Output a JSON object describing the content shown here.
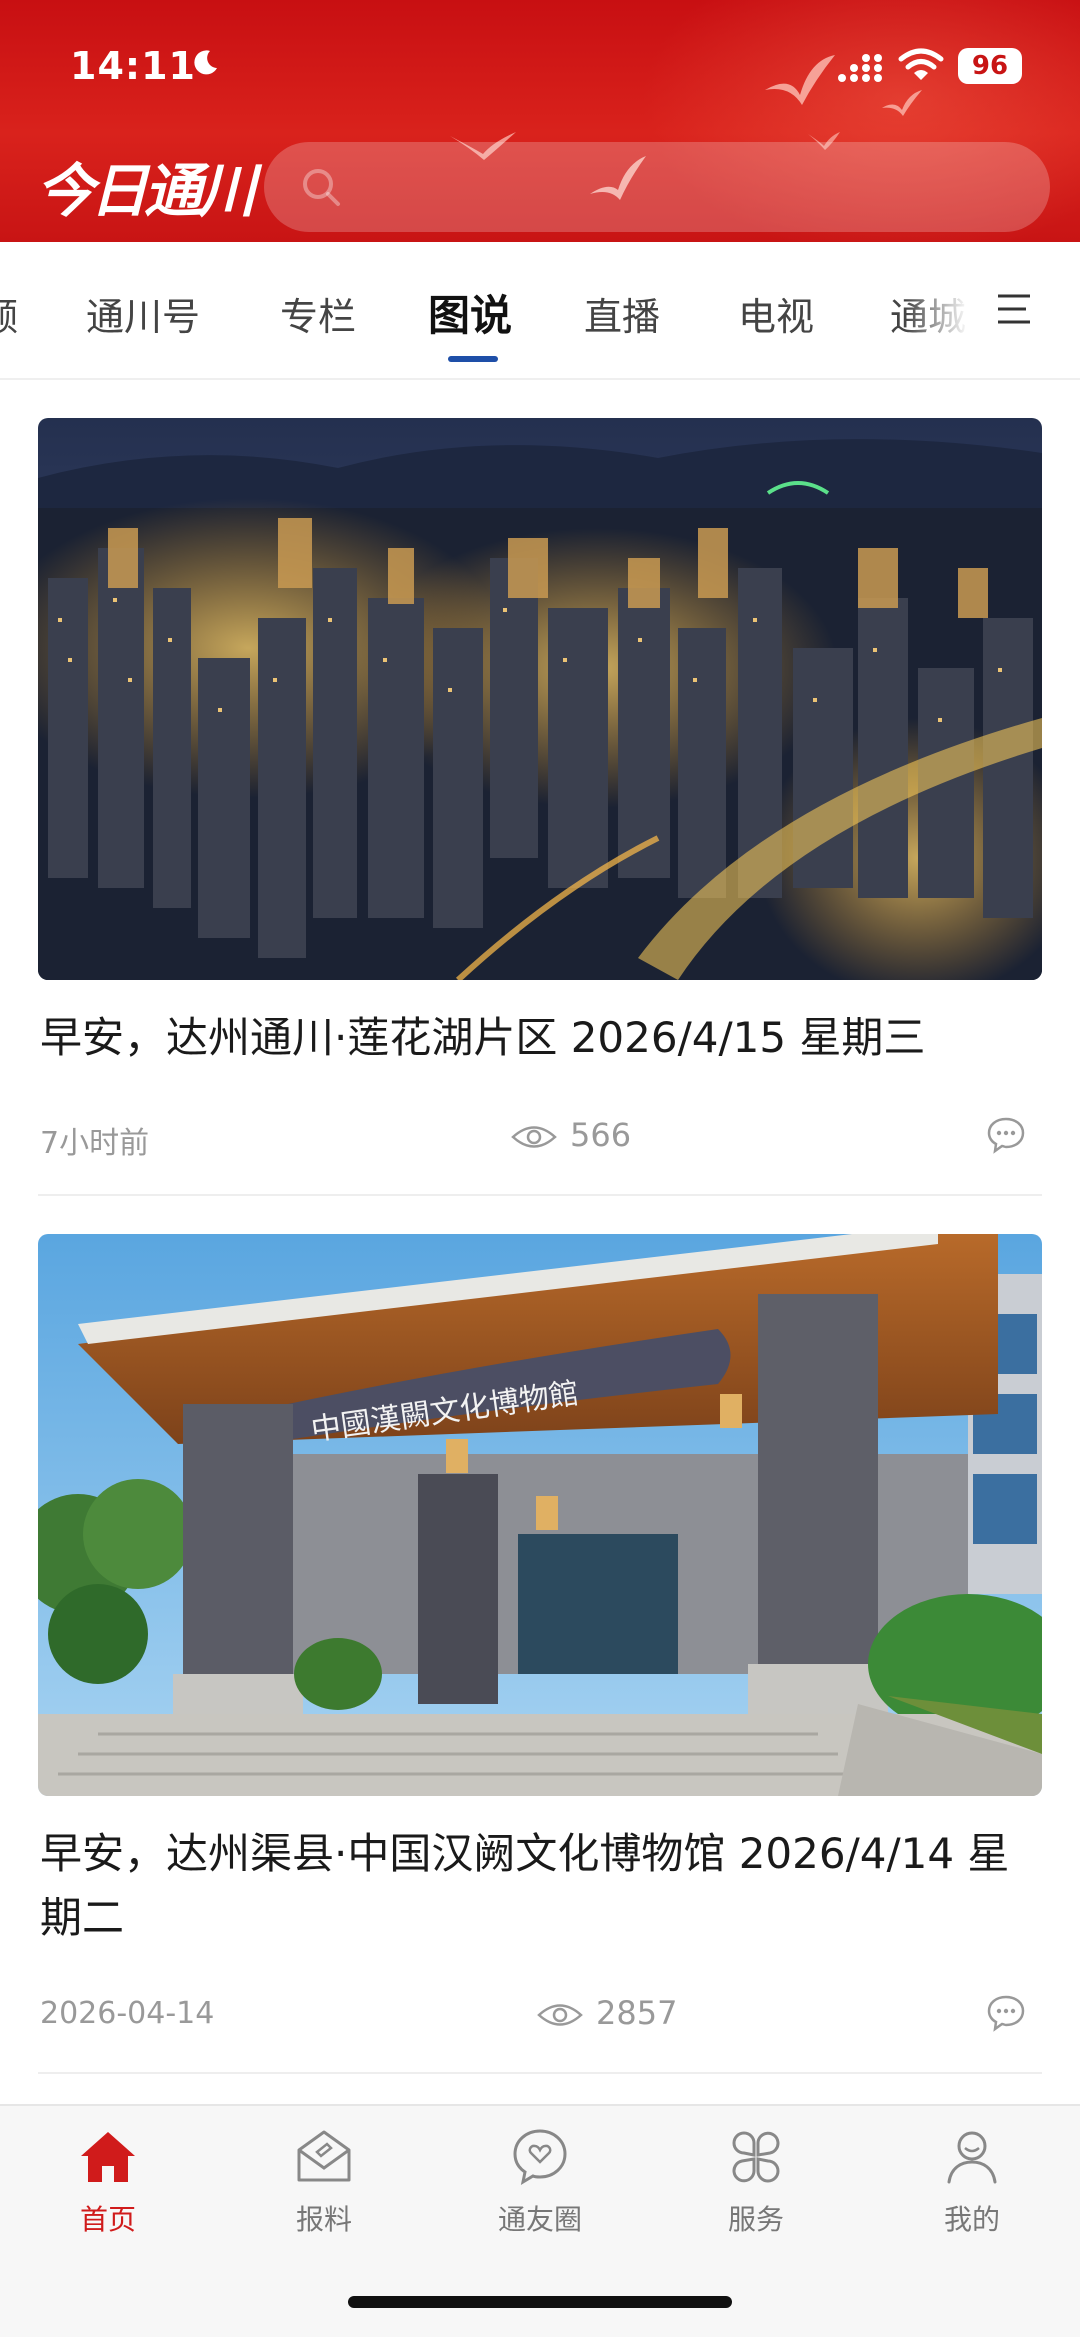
{
  "status_bar": {
    "time": "14:11",
    "battery": "96"
  },
  "header": {
    "logo_text": "今日通川",
    "search_placeholder": ""
  },
  "tabs": [
    {
      "label": "频"
    },
    {
      "label": "通川号"
    },
    {
      "label": "专栏"
    },
    {
      "label": "图说",
      "active": true
    },
    {
      "label": "直播"
    },
    {
      "label": "电视"
    },
    {
      "label": "通城"
    }
  ],
  "feed": [
    {
      "title": "早安，达州通川·莲花湖片区 2026/4/15 星期三",
      "time": "7小时前",
      "views": "566",
      "image_alt": "夜景城市"
    },
    {
      "title": "早安，达州渠县·中国汉阙文化博物馆 2026/4/14 星期二",
      "time": "2026-04-14",
      "views": "2857",
      "image_sign": "中國漢闕文化博物館"
    }
  ],
  "bottom_nav": [
    {
      "label": "首页",
      "icon": "home-icon",
      "active": true
    },
    {
      "label": "报料",
      "icon": "report-icon"
    },
    {
      "label": "通友圈",
      "icon": "friends-icon"
    },
    {
      "label": "服务",
      "icon": "services-icon"
    },
    {
      "label": "我的",
      "icon": "profile-icon"
    }
  ],
  "colors": {
    "brand_red": "#d01b1b",
    "tab_indicator": "#1e4fa8"
  }
}
